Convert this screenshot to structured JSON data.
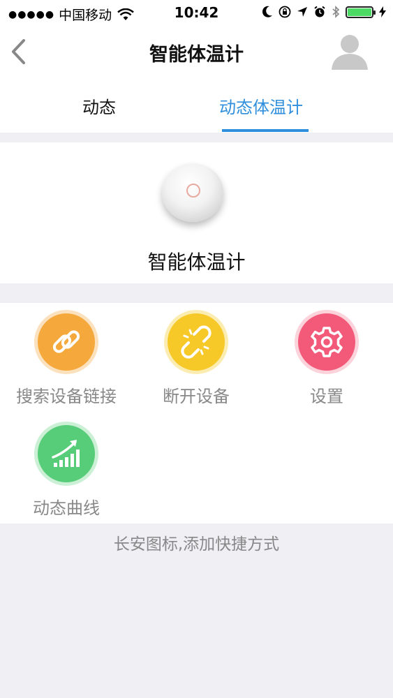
{
  "status_bar": {
    "carrier": "中国移动",
    "time": "10:42"
  },
  "nav": {
    "title": "智能体温计"
  },
  "tabs": [
    {
      "label": "动态",
      "active": false
    },
    {
      "label": "动态体温计",
      "active": true
    }
  ],
  "device": {
    "name": "智能体温计"
  },
  "actions": [
    {
      "label": "搜索设备链接",
      "icon": "link-icon",
      "color": "#f5a93c"
    },
    {
      "label": "断开设备",
      "icon": "broken-link-icon",
      "color": "#f6c928"
    },
    {
      "label": "设置",
      "icon": "gear-icon",
      "color": "#f35a7a"
    },
    {
      "label": "动态曲线",
      "icon": "trend-chart-icon",
      "color": "#58cd79"
    }
  ],
  "hint": "长安图标,添加快捷方式",
  "colors": {
    "accent": "#2f8fdd"
  }
}
